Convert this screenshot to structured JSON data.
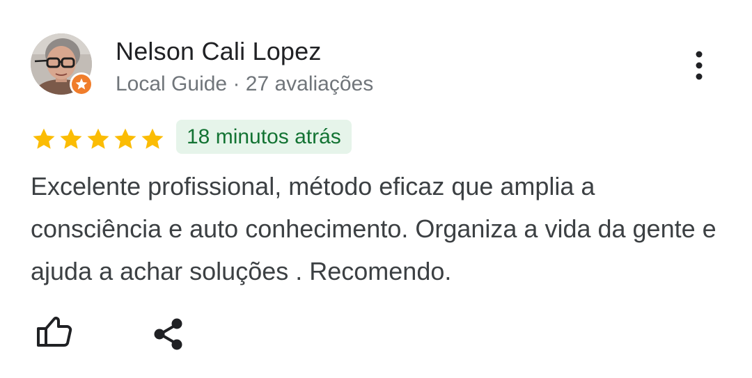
{
  "reviewer": {
    "name": "Nelson Cali Lopez",
    "meta": "Local Guide · 27 avaliações",
    "avatar_icon": "reviewer-avatar",
    "badge_icon": "local-guide-star-badge",
    "badge_color": "#f07d2b"
  },
  "rating": {
    "stars": 5,
    "max_stars": 5,
    "star_color": "#fbbc04",
    "time_ago": "18 minutos atrás",
    "time_chip_bg": "#e6f4ea",
    "time_chip_color": "#137333"
  },
  "review": {
    "text": "Excelente profissional, método eficaz que amplia a consciência e auto conhecimento. Organiza a vida da gente e ajuda a achar soluções . Recomendo."
  },
  "actions": {
    "more_icon": "more-vert-icon",
    "like_icon": "thumb-up-icon",
    "share_icon": "share-icon"
  }
}
